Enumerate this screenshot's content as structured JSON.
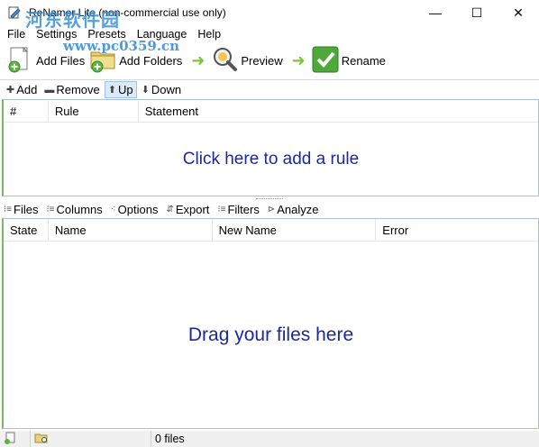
{
  "window": {
    "title": "ReNamer Lite (non-commercial use only)",
    "controls": {
      "minimize": "—",
      "maximize": "☐",
      "close": "✕"
    }
  },
  "watermark": {
    "line1": "河东软件园",
    "line2": "www.pc0359.cn"
  },
  "menu": {
    "items": [
      "File",
      "Settings",
      "Presets",
      "Language",
      "Help"
    ]
  },
  "toolbar": {
    "add_files": "Add Files",
    "add_folders": "Add Folders",
    "preview": "Preview",
    "rename": "Rename"
  },
  "rules_toolbar": {
    "add": "Add",
    "remove": "Remove",
    "up": "Up",
    "down": "Down"
  },
  "rules_table": {
    "columns": [
      "#",
      "Rule",
      "Statement"
    ],
    "empty_hint": "Click here to add a rule"
  },
  "files_toolbar": {
    "files": "Files",
    "columns": "Columns",
    "options": "Options",
    "export": "Export",
    "filters": "Filters",
    "analyze": "Analyze"
  },
  "files_table": {
    "columns": [
      "State",
      "Name",
      "New Name",
      "Error"
    ],
    "empty_hint": "Drag your files here"
  },
  "status": {
    "file_count": "0 files"
  },
  "colors": {
    "hint_text": "#1a2a9c",
    "panel_accent": "#7cb66a",
    "arrow_green": "#7cc243"
  }
}
